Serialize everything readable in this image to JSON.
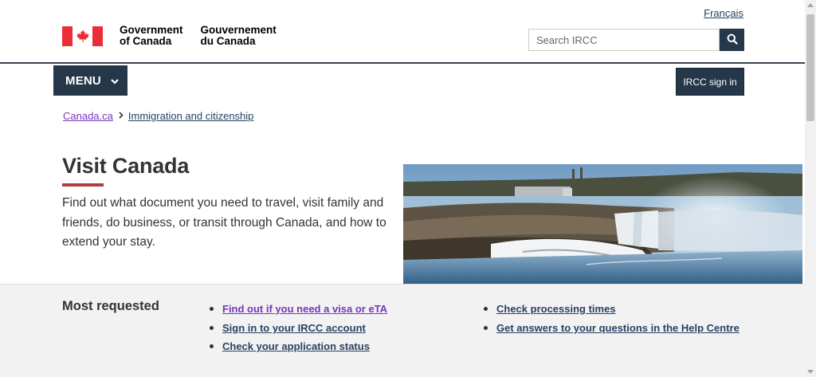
{
  "header": {
    "lang_toggle": "Français",
    "wordmark_en_line1": "Government",
    "wordmark_en_line2": "of Canada",
    "wordmark_fr_line1": "Gouvernement",
    "wordmark_fr_line2": "du Canada",
    "search_placeholder": "Search IRCC",
    "flag_colors": {
      "red": "#eb2d37",
      "white": "#ffffff"
    }
  },
  "nav": {
    "menu_label": "MENU",
    "signin_label": "IRCC sign in"
  },
  "breadcrumb": [
    "Canada.ca",
    "Immigration and citizenship"
  ],
  "main": {
    "title": "Visit Canada",
    "intro": "Find out what document you need to travel, visit family and friends, do business, or transit through Canada, and how to extend your stay."
  },
  "most_requested": {
    "heading": "Most requested",
    "col1": [
      "Find out if you need a visa or eTA",
      "Sign in to your IRCC account",
      "Check your application status"
    ],
    "col2": [
      "Check processing times",
      "Get answers to your questions in the Help Centre"
    ]
  },
  "colors": {
    "navy": "#26374a",
    "link": "#284162",
    "visited": "#7834bc",
    "accent_red": "#af3c43"
  }
}
